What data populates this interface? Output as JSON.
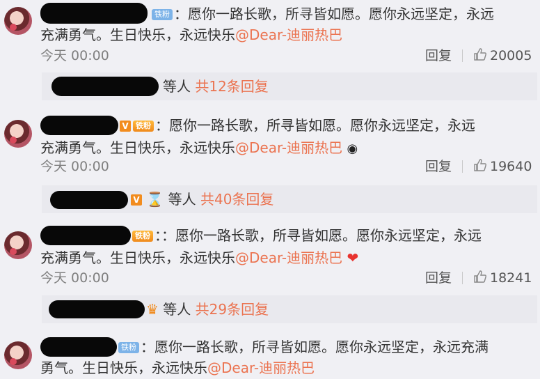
{
  "comments": [
    {
      "badge": "铁粉",
      "text_line1": "：愿你一路长歌，所寻皆如愿。愿你永远坚定，永远",
      "text_line2_pre": "充满勇气。生日快乐，永远快乐",
      "mention": "@Dear-迪丽热巴",
      "time": "今天 00:00",
      "reply_label": "回复",
      "likes": "20005",
      "sub_suffix": "等人",
      "sub_count": "共12条回复"
    },
    {
      "badge": "铁粉",
      "text_line1": "：愿你一路长歌，所寻皆如愿。愿你永远坚定，永远",
      "text_line2_pre": "充满勇气。生日快乐，永远快乐",
      "mention": "@Dear-迪丽热巴",
      "time": "今天 00:00",
      "reply_label": "回复",
      "likes": "19640",
      "sub_suffix": "等人",
      "sub_count": "共40条回复"
    },
    {
      "badge": "铁粉",
      "text_line1": "：：愿你一路长歌，所寻皆如愿。愿你永远坚定，永远",
      "text_line2_pre": "充满勇气。生日快乐，永远快乐",
      "mention": "@Dear-迪丽热巴",
      "time": "今天 00:00",
      "reply_label": "回复",
      "likes": "18241",
      "sub_suffix": "等人",
      "sub_count": "共29条回复"
    },
    {
      "badge": "铁粉",
      "text_line1": "：愿你一路长歌，所寻皆如愿。愿你永远坚定，永远充满",
      "text_line2_pre": "勇气。生日快乐，永远快乐",
      "mention": "@Dear-迪丽热巴"
    }
  ],
  "colors": {
    "mention": "#eb7350",
    "background": "#f0f0f4",
    "subbox": "#e9e9ee"
  },
  "icons": {
    "like": "thumbs-up-icon",
    "heart": "heart-icon",
    "vip": "v-badge-icon"
  }
}
